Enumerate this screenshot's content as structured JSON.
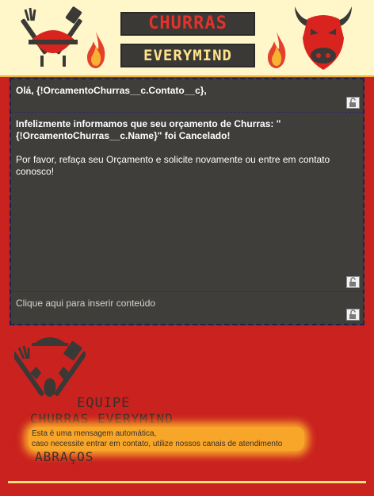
{
  "header": {
    "brand_line_1": "CHURRAS",
    "brand_line_2": "EVERYMIND",
    "icons": [
      "grill-tools-icon",
      "flame-icon",
      "bull-head-icon"
    ],
    "colors": {
      "background": "#fff6c9",
      "accent": "#f2b43a",
      "brand_dark": "#3a3936",
      "brand_red": "#e2332b"
    }
  },
  "content": {
    "greeting_prefix": "Olá, ",
    "greeting_merge_field": "{!OrcamentoChurras__c.Contato__c},",
    "body_line_1": "Infelizmente informamos que seu orçamento de Churras: \"",
    "body_line_2": "{!OrcamentoChurras__c.Name}\" foi Cancelado!",
    "body_paragraph_2": "Por favor, refaça seu Orçamento e solicite novamente ou entre em contato conosco!",
    "placeholder_text": "Clique aqui para inserir conteúdo",
    "lock_icon": "lock-icon"
  },
  "footer": {
    "team_line_1": "EQUIPE",
    "team_line_2": "CHURRAS EVERYMIND",
    "note_line_1": "Esta é uma mensagem automática,",
    "note_line_2": "caso necessite entrar em contato, utilize nossos canais de atendimento",
    "signoff": "ABRAÇOS",
    "colors": {
      "background": "#c9221f",
      "highlight": "#f8a62a",
      "rule": "#ffe078"
    }
  }
}
